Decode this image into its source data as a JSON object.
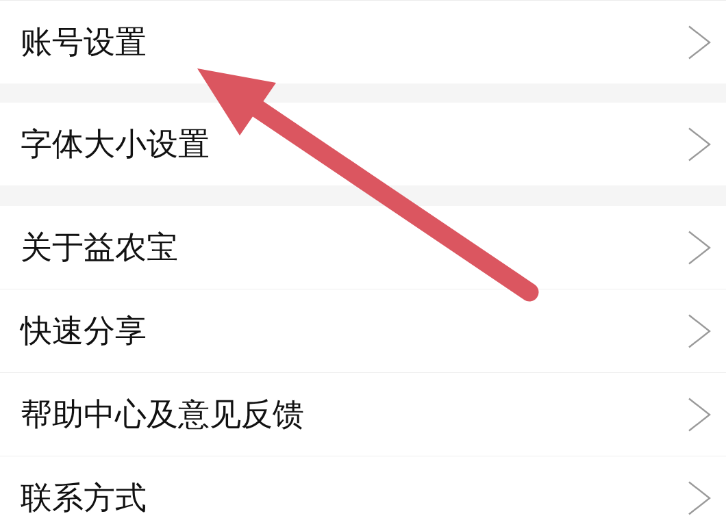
{
  "settings_groups": [
    {
      "items": [
        {
          "label": "账号设置"
        }
      ]
    },
    {
      "items": [
        {
          "label": "字体大小设置"
        }
      ]
    },
    {
      "items": [
        {
          "label": "关于益农宝"
        },
        {
          "label": "快速分享"
        },
        {
          "label": "帮助中心及意见反馈"
        },
        {
          "label": "联系方式"
        }
      ]
    }
  ]
}
